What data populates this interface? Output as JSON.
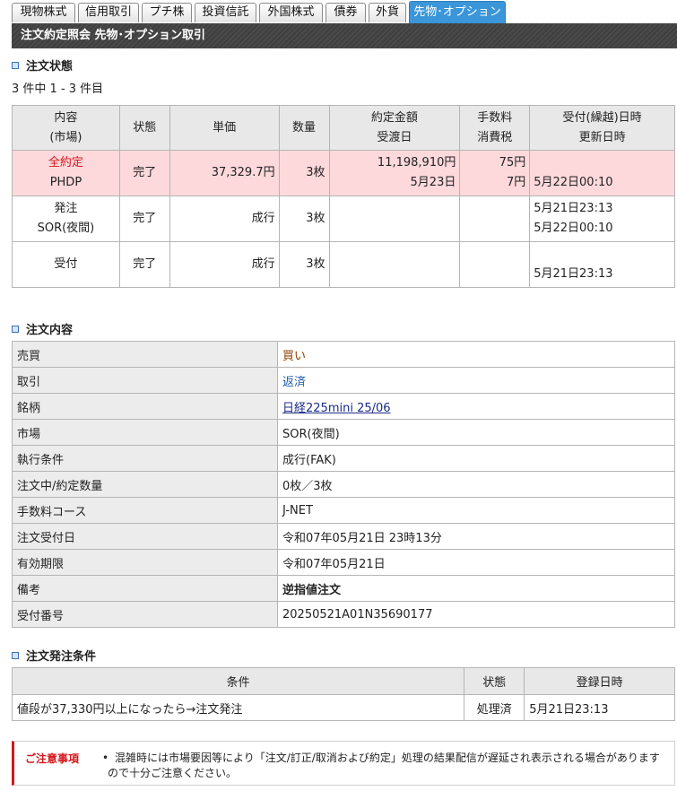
{
  "tabs": [
    {
      "label": "現物株式"
    },
    {
      "label": "信用取引"
    },
    {
      "label": "プチ株"
    },
    {
      "label": "投資信託"
    },
    {
      "label": "外国株式"
    },
    {
      "label": "債券"
    },
    {
      "label": "外貨"
    },
    {
      "label": "先物･オプション",
      "active": true
    }
  ],
  "header": {
    "title": "注文約定照会 先物･オプション取引"
  },
  "order_status": {
    "title": "注文状態",
    "count_text": "3 件中 1 - 3 件目",
    "columns": {
      "content": [
        "内容",
        "(市場)"
      ],
      "status": "状態",
      "price": "単価",
      "qty": "数量",
      "amount": [
        "約定金額",
        "受渡日"
      ],
      "fee": [
        "手数料",
        "消費税"
      ],
      "date": [
        "受付(繰越)日時",
        "更新日時"
      ]
    },
    "rows": [
      {
        "content1": "全約定",
        "content2": "PHDP",
        "status": "完了",
        "price": "37,329.7円",
        "qty": "3枚",
        "amount1": "11,198,910円",
        "amount2": "5月23日",
        "fee1": "75円",
        "fee2": "7円",
        "date1": "",
        "date2": "5月22日00:10"
      },
      {
        "content1": "発注",
        "content2": "SOR(夜間)",
        "status": "完了",
        "price": "成行",
        "qty": "3枚",
        "amount1": "",
        "amount2": "",
        "fee1": "",
        "fee2": "",
        "date1": "5月21日23:13",
        "date2": "5月22日00:10"
      },
      {
        "content1": "受付",
        "content2": "",
        "status": "完了",
        "price": "成行",
        "qty": "3枚",
        "amount1": "",
        "amount2": "",
        "fee1": "",
        "fee2": "",
        "date1": "",
        "date2": "5月21日23:13"
      }
    ]
  },
  "order_detail": {
    "title": "注文内容",
    "rows": [
      {
        "label": "売買",
        "value": "買い"
      },
      {
        "label": "取引",
        "value": "返済"
      },
      {
        "label": "銘柄",
        "value": "日経225mini 25/06"
      },
      {
        "label": "市場",
        "value": "SOR(夜間)"
      },
      {
        "label": "執行条件",
        "value": "成行(FAK)"
      },
      {
        "label": "注文中/約定数量",
        "value": "0枚／3枚"
      },
      {
        "label": "手数料コース",
        "value": "J-NET"
      },
      {
        "label": "注文受付日",
        "value": "令和07年05月21日 23時13分"
      },
      {
        "label": "有効期限",
        "value": "令和07年05月21日"
      },
      {
        "label": "備考",
        "value": "逆指値注文"
      },
      {
        "label": "受付番号",
        "value": "20250521A01N35690177"
      }
    ]
  },
  "order_condition": {
    "title": "注文発注条件",
    "columns": {
      "condition": "条件",
      "status": "状態",
      "date": "登録日時"
    },
    "row": {
      "condition": "値段が37,330円以上になったら→注文発注",
      "status": "処理済",
      "date": "5月21日23:13"
    }
  },
  "notice": {
    "title": "ご注意事項",
    "bullet": "•",
    "text": "混雑時には市場要因等により「注文/訂正/取消および約定」処理の結果配信が遅延され表示される場合がありますので十分ご注意ください。"
  },
  "colors": {
    "active_tab": "#3a96d8",
    "filled_row": "#fdd9dc",
    "alert": "#d4161c"
  }
}
